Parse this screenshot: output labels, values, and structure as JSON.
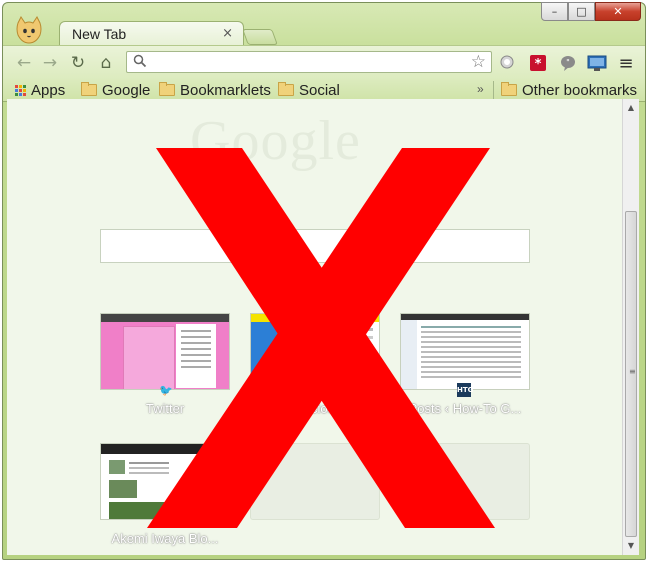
{
  "window": {
    "controls": [
      "–",
      "□",
      "✕"
    ]
  },
  "tab": {
    "title": "New Tab",
    "close": "×"
  },
  "toolbar": {
    "back": "←",
    "forward": "→",
    "reload": "↻",
    "home": "⌂",
    "omnibox_value": "",
    "star": "☆",
    "menu": "≡"
  },
  "bookmarks": {
    "apps": "Apps",
    "items": [
      "Google",
      "Bookmarklets",
      "Social"
    ],
    "chevron": "»",
    "other": "Other bookmarks"
  },
  "content": {
    "logo": "Google",
    "tiles": [
      {
        "label": "Twitter",
        "icon": "twitter-icon"
      },
      {
        "label": "Delicious",
        "icon": "delicious-icon"
      },
      {
        "label": "Posts ‹ How-To G...",
        "icon": "htg-icon",
        "badge": "HTG"
      },
      {
        "label": "Akemi Iwaya Blo...",
        "icon": "none"
      },
      {
        "label": "",
        "icon": "none"
      },
      {
        "label": "",
        "icon": "none"
      }
    ]
  },
  "overlay": {
    "mark": "X",
    "color": "#ff0000"
  },
  "colors": {
    "theme": "#c3dc93",
    "content_bg": "#f1f7ea"
  }
}
